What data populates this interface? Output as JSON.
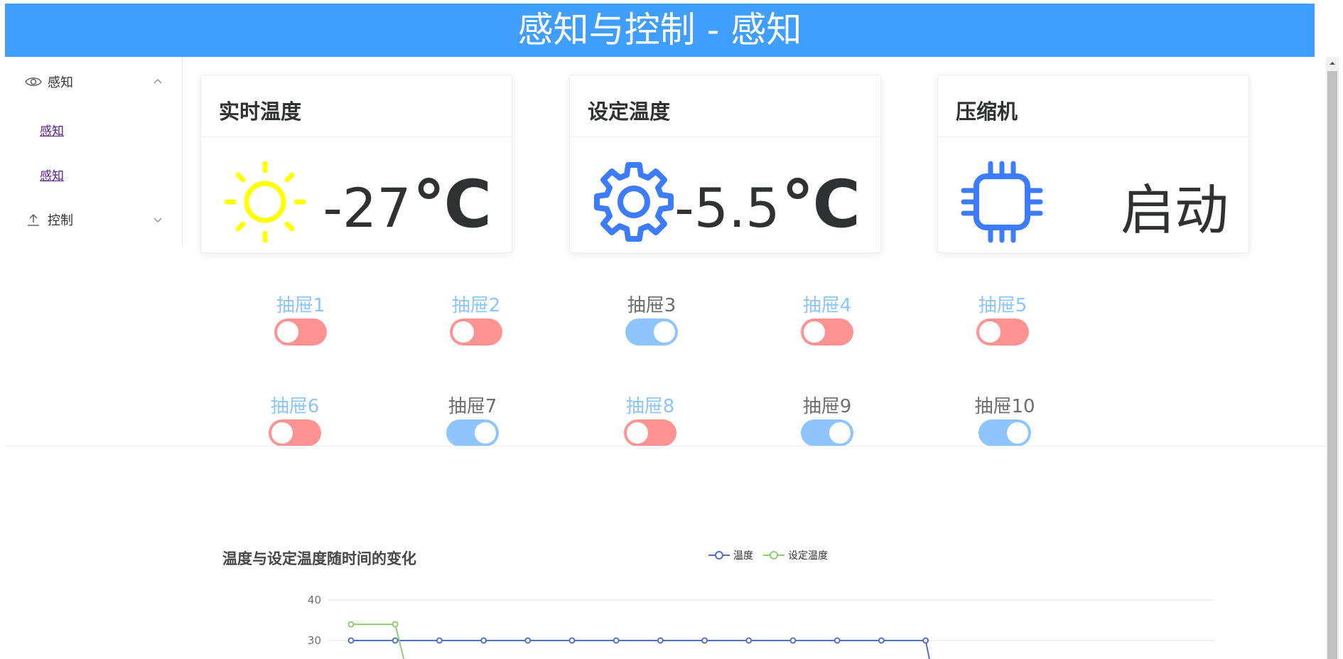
{
  "header": {
    "title": "感知与控制 - 感知"
  },
  "sidebar": {
    "menu1": {
      "label": "感知",
      "icon": "eye-icon",
      "expanded": true
    },
    "links": [
      "感知",
      "感知"
    ],
    "menu2": {
      "label": "控制",
      "icon": "upload-icon",
      "expanded": false
    }
  },
  "cards": {
    "realtime": {
      "title": "实时温度",
      "value": "-27",
      "unit": "℃",
      "icon": "sun-icon",
      "icon_color": "#ffff00"
    },
    "setpoint": {
      "title": "设定温度",
      "value": "-5.5",
      "unit": "℃",
      "icon": "gear-icon",
      "icon_color": "#3d7bff"
    },
    "compressor": {
      "title": "压缩机",
      "value": "启动",
      "icon": "chip-icon",
      "icon_color": "#3d7bff"
    }
  },
  "drawers": [
    {
      "label": "抽屉1",
      "state": "off"
    },
    {
      "label": "抽屉2",
      "state": "off"
    },
    {
      "label": "抽屉3",
      "state": "on"
    },
    {
      "label": "抽屉4",
      "state": "off"
    },
    {
      "label": "抽屉5",
      "state": "off"
    },
    {
      "label": "抽屉6",
      "state": "off"
    },
    {
      "label": "抽屉7",
      "state": "on"
    },
    {
      "label": "抽屉8",
      "state": "off"
    },
    {
      "label": "抽屉9",
      "state": "on"
    },
    {
      "label": "抽屉10",
      "state": "on"
    }
  ],
  "colors": {
    "switch_off": "#ff9393",
    "switch_on": "#8ec5ff",
    "header": "#409eff"
  },
  "chart_data": {
    "type": "line",
    "title": "温度与设定温度随时间的变化",
    "y_ticks": [
      "40",
      "30"
    ],
    "ylim_visible": [
      30,
      40
    ],
    "series": [
      {
        "name": "温度",
        "color": "#5470c6",
        "values": [
          30,
          30,
          30,
          30,
          30,
          30,
          30,
          30,
          30,
          30,
          30,
          30,
          30,
          30
        ]
      },
      {
        "name": "设定温度",
        "color": "#91cc75",
        "values": [
          34,
          34
        ]
      }
    ]
  }
}
